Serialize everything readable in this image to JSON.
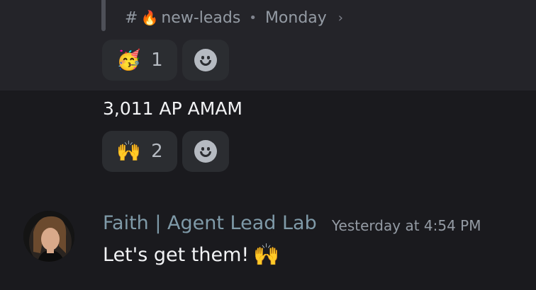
{
  "forwarded": {
    "channel_hash": "#",
    "channel_emoji": "🔥",
    "channel_name": "new-leads",
    "separator": "•",
    "day": "Monday",
    "chevron": "›"
  },
  "reactions_top": [
    {
      "emoji": "🥳",
      "count": "1"
    }
  ],
  "message": {
    "text": "3,011 AP AMAM"
  },
  "reactions_mid": [
    {
      "emoji": "🙌",
      "count": "2"
    }
  ],
  "reply": {
    "author": "Faith | Agent Lead Lab",
    "timestamp": "Yesterday at 4:54 PM",
    "text": "Let's get them!",
    "emoji": "🙌"
  },
  "icons": {
    "add_reaction": "smile-add-icon",
    "avatar": "user-avatar"
  }
}
